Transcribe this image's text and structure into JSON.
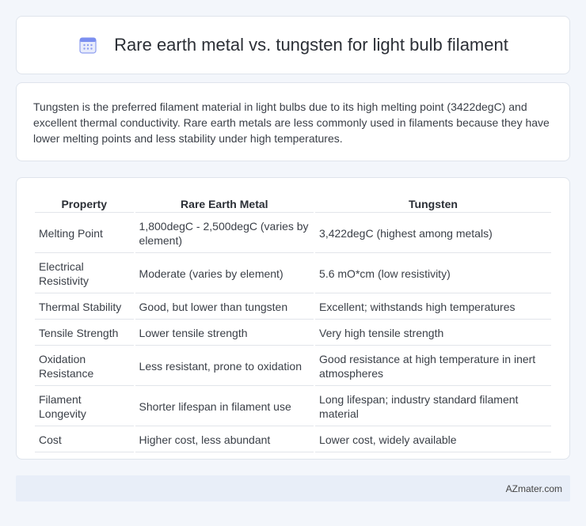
{
  "header": {
    "title": "Rare earth metal vs. tungsten for light bulb filament",
    "icon": "calendar-icon"
  },
  "intro": {
    "text": "Tungsten is the preferred filament material in light bulbs due to its high melting point (3422degC) and excellent thermal conductivity. Rare earth metals are less commonly used in filaments because they have lower melting points and less stability under high temperatures."
  },
  "table": {
    "headers": [
      "Property",
      "Rare Earth Metal",
      "Tungsten"
    ],
    "rows": [
      [
        "Melting Point",
        "1,800degC - 2,500degC (varies by element)",
        "3,422degC (highest among metals)"
      ],
      [
        "Electrical Resistivity",
        "Moderate (varies by element)",
        "5.6 mO*cm (low resistivity)"
      ],
      [
        "Thermal Stability",
        "Good, but lower than tungsten",
        "Excellent; withstands high temperatures"
      ],
      [
        "Tensile Strength",
        "Lower tensile strength",
        "Very high tensile strength"
      ],
      [
        "Oxidation Resistance",
        "Less resistant, prone to oxidation",
        "Good resistance at high temperature in inert atmospheres"
      ],
      [
        "Filament Longevity",
        "Shorter lifespan in filament use",
        "Long lifespan; industry standard filament material"
      ],
      [
        "Cost",
        "Higher cost, less abundant",
        "Lower cost, widely available"
      ]
    ]
  },
  "footer": {
    "brand": "AZmater.com"
  },
  "colors": {
    "background": "#f3f6fb",
    "icon_accent": "#7b8ff0",
    "footer_bg": "#e8eef8"
  }
}
